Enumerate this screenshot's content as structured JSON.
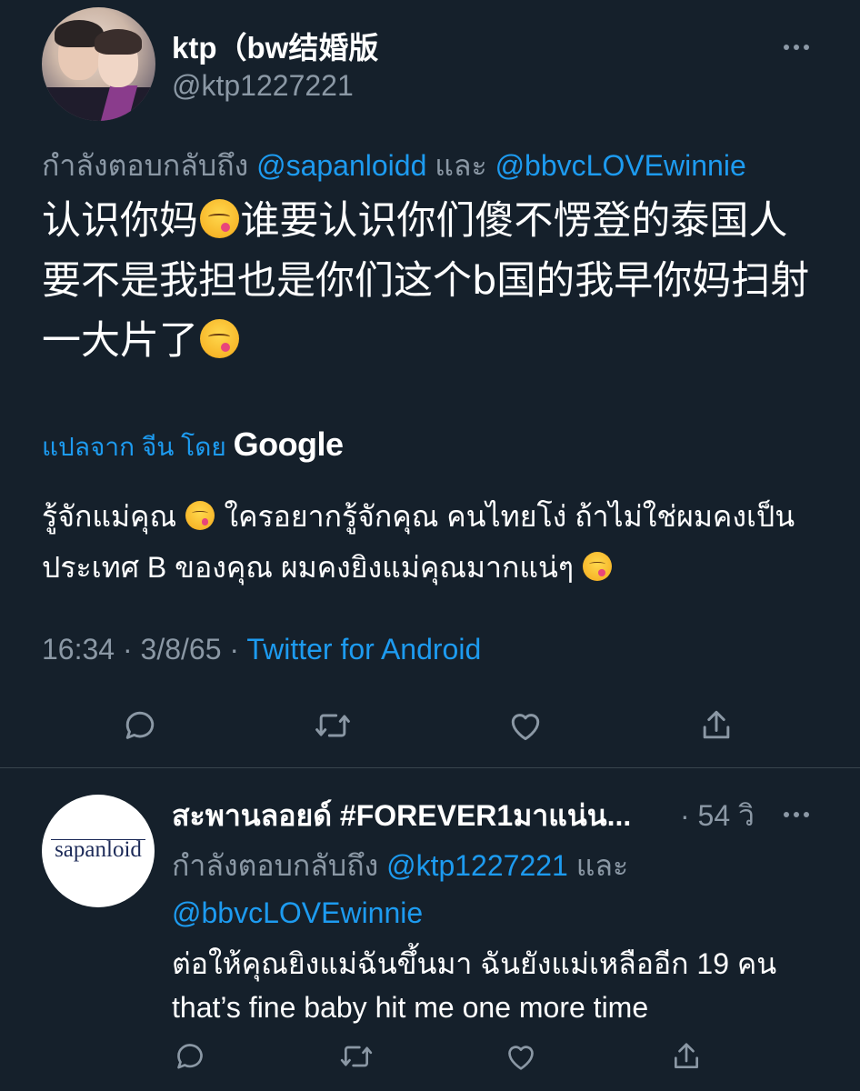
{
  "tweet": {
    "author": {
      "name": "ktp（bw结婚版",
      "handle": "@ktp1227221"
    },
    "replying_prefix": "กำลังตอบกลับถึง",
    "replying_users": [
      "@sapanloidd",
      "@bbvcLOVEwinnie"
    ],
    "replying_conjunction": "และ",
    "text_parts": [
      "认识你妈",
      "谁要认识你们傻不愣登的泰国人 要不是我担也是你们这个b国的我早你妈扫射一大片了"
    ],
    "translated_from_label": "แปลจาก จีน โดย",
    "translator": "Google",
    "translation_parts": [
      "รู้จักแม่คุณ",
      "ใครอยากรู้จักคุณ คนไทยโง่ ถ้าไม่ใช่ผมคงเป็นประเทศ B ของคุณ ผมคงยิงแม่คุณมากแน่ๆ"
    ],
    "emoji": "face-savoring-food",
    "timestamp": "16:34 · 3/8/65 ·",
    "source": "Twitter for Android",
    "actions": [
      "reply-icon",
      "retweet-icon",
      "like-icon",
      "share-icon"
    ]
  },
  "reply": {
    "author": {
      "name": "สะพานลอยด์ #FOREVER1มาแน่น...",
      "avatar_text": "sapanloid"
    },
    "time": "· 54 วิ",
    "replying_prefix": "กำลังตอบกลับถึง",
    "replying_users": [
      "@ktp1227221",
      "@bbvcLOVEwinnie"
    ],
    "replying_conjunction": "และ",
    "text": "ต่อให้คุณยิงแม่ฉันขึ้นมา ฉันยังแม่เหลืออีก 19 คน that’s fine baby hit me one more time",
    "actions": [
      "reply-icon",
      "retweet-icon",
      "like-icon",
      "share-icon"
    ]
  },
  "colors": {
    "background": "#15202b",
    "link": "#1d9bf0",
    "secondary_text": "#8b98a5",
    "divider": "#38444d"
  }
}
